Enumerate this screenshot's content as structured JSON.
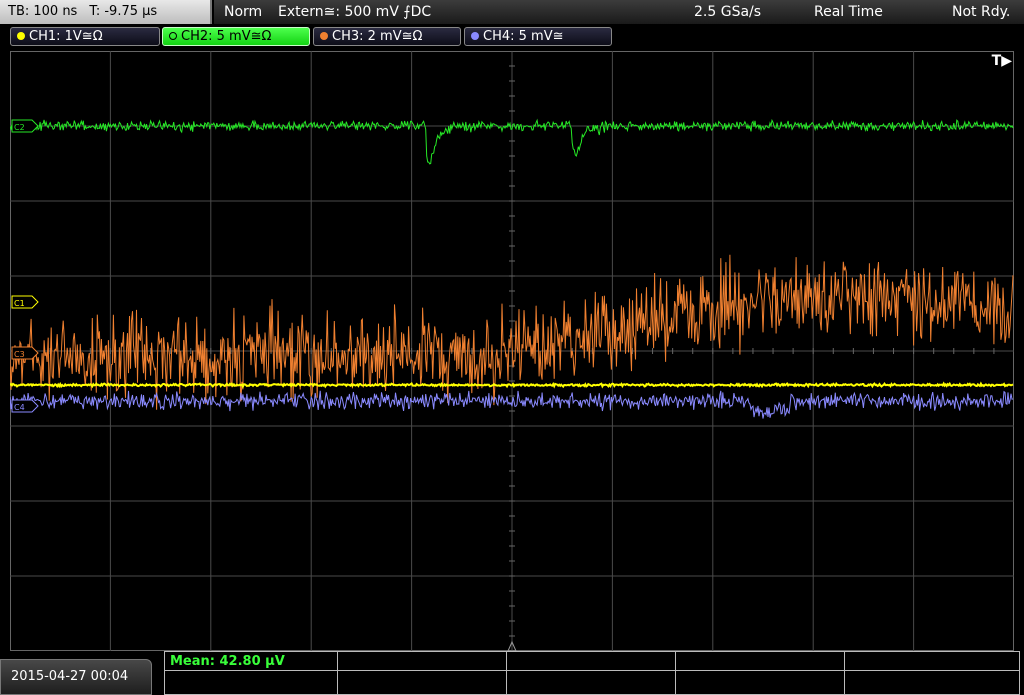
{
  "timebase": {
    "tb": "TB: 100 ns",
    "offset": "T: -9.75 µs"
  },
  "acquisition": {
    "mode": "Norm",
    "trigger": "Extern≅: 500 mV ⨍DC",
    "sample_rate": "2.5 GSa/s",
    "acq_mode": "Real Time",
    "status": "Not Rdy."
  },
  "channels": [
    {
      "label": "CH1: 1V≅Ω",
      "color": "#ffff00",
      "marker": "C1"
    },
    {
      "label": "CH2: 5 mV≅Ω",
      "color": "#26e826",
      "marker": "C2",
      "active": true
    },
    {
      "label": "CH3: 2 mV≅Ω",
      "color": "#f08030",
      "marker": "C3"
    },
    {
      "label": "CH4: 5 mV≅",
      "color": "#8a8aff",
      "marker": "C4"
    }
  ],
  "trigger_marker": "T▶",
  "measurement": {
    "mean": "Mean: 42.80 µV"
  },
  "datetime": "2015-04-27 00:04",
  "colors": {
    "grid": "#4a4a4a",
    "background": "#000000"
  }
}
